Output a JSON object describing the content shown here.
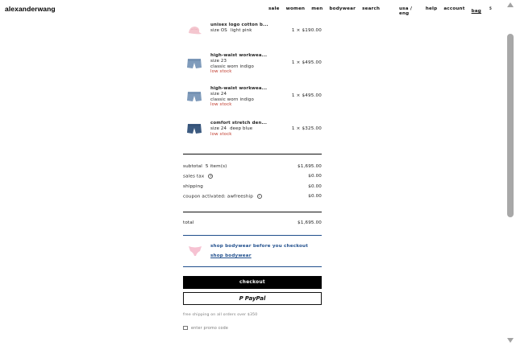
{
  "header": {
    "logo": "alexanderwang",
    "nav_left": [
      "sale",
      "women",
      "men",
      "bodywear",
      "search"
    ],
    "nav_right": {
      "locale": "usa / eng",
      "help": "help",
      "account": "account",
      "bag": "bag",
      "bag_count": "5"
    }
  },
  "items": [
    {
      "name": "unisex logo cotton b...",
      "size": "size OS",
      "color": "light pink",
      "stock": "",
      "qty_price": "1 × $190.00",
      "icon": "pink-cap-icon"
    },
    {
      "name": "high-waist workwea...",
      "size": "size 23",
      "color": "classic worn indigo",
      "stock": "low stock",
      "qty_price": "1 × $495.00",
      "icon": "denim-shorts-icon"
    },
    {
      "name": "high-waist workwea...",
      "size": "size 24",
      "color": "classic worn indigo",
      "stock": "low stock",
      "qty_price": "1 × $495.00",
      "icon": "denim-shorts-icon"
    },
    {
      "name": "comfort stretch den...",
      "size": "size 24",
      "color": "deep blue",
      "stock": "low stock",
      "qty_price": "1 × $325.00",
      "icon": "dark-denim-shorts-icon"
    }
  ],
  "summary": {
    "subtotal_label": "subtotal",
    "subtotal_count": "5 item(s)",
    "subtotal_value": "$1,695.00",
    "tax_label": "sales tax",
    "tax_value": "$0.00",
    "shipping_label": "shipping",
    "shipping_value": "$0.00",
    "coupon_label": "coupon activated: awfreeship",
    "coupon_value": "$0.00",
    "total_label": "total",
    "total_value": "$1,695.00"
  },
  "promo": {
    "headline": "shop bodywear before you checkout",
    "link": "shop bodywear"
  },
  "actions": {
    "checkout": "checkout",
    "paypal": "PayPal"
  },
  "footer": {
    "shipping_note": "free shipping on all orders over $350",
    "promo_code": "enter promo code"
  },
  "colors": {
    "low_stock": "#c0392b",
    "promo_blue": "#1f4e8c"
  }
}
